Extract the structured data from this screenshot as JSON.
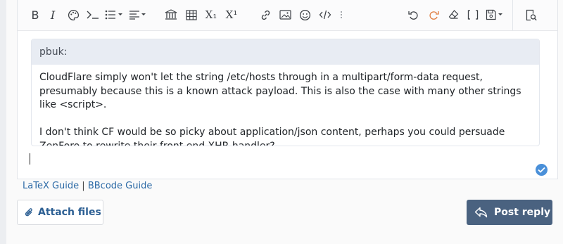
{
  "toolbar": {
    "list_items": [
      "bold-icon",
      "italic-icon",
      "palette-icon",
      "inline-code-icon",
      "bullet-list-icon",
      "align-icon",
      "institution-icon",
      "table-icon",
      "subscript-icon",
      "superscript-icon",
      "link-icon",
      "image-icon",
      "emoji-icon",
      "code-icon",
      "more-icon",
      "undo-icon",
      "redo-icon",
      "eraser-icon",
      "brackets-icon",
      "save-draft-icon",
      "preview-icon"
    ],
    "bold": "B",
    "italic": "I",
    "subscript": "X₁",
    "superscript": "X¹",
    "brackets": "[ ]"
  },
  "quote": {
    "author": "pbuk:",
    "paragraphs": [
      "CloudFlare simply won't let the string /etc/hosts through in a multipart/form-data request, presumably because this is a known attack payload.  This is also the case with many other strings like <script>.",
      "I don't think CF would be so picky about application/json content, perhaps you could persuade ZenForo to rewrite their front end XHR handler?"
    ]
  },
  "guides": {
    "latex": "LaTeX Guide",
    "separator": "|",
    "bbcode": "BBcode Guide"
  },
  "actions": {
    "attach": "Attach files",
    "reply": "Post reply"
  },
  "colors": {
    "accent": "#4a6280",
    "link": "#2c6aa6",
    "check": "#4a90d9",
    "redo": "#e07c3e"
  }
}
